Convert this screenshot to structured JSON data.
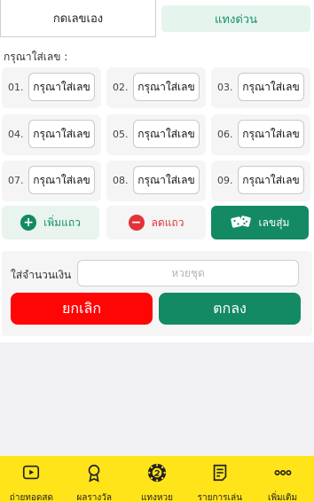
{
  "tabs": {
    "manual": "กดเลขเอง",
    "quick": "แทงด่วน"
  },
  "section_label": "กรุณาใส่เลข :",
  "number_inputs": {
    "placeholder": "กรุณาใส่เลข",
    "items": [
      {
        "label": "01."
      },
      {
        "label": "02."
      },
      {
        "label": "03."
      },
      {
        "label": "04."
      },
      {
        "label": "05."
      },
      {
        "label": "06."
      },
      {
        "label": "07."
      },
      {
        "label": "08."
      },
      {
        "label": "09."
      }
    ]
  },
  "actions": {
    "add_row": "เพิ่มแถว",
    "remove_row": "ลดแถว",
    "random": "เลขสุ่ม"
  },
  "amount": {
    "label": "ใส่จำนวนเงิน",
    "placeholder": "หวยชุด",
    "cancel": "ยกเลิก",
    "confirm": "ตกลง"
  },
  "bottom_nav": [
    {
      "label": "ถ่ายทอดสด",
      "icon": "play-video-icon"
    },
    {
      "label": "ผลรางวัล",
      "icon": "award-medal-icon"
    },
    {
      "label": "แทงหวย",
      "icon": "lottery-ball-icon"
    },
    {
      "label": "รายการเล่น",
      "icon": "list-document-icon"
    },
    {
      "label": "เพิ่มเติม",
      "icon": "more-dots-icon"
    }
  ],
  "colors": {
    "primary_green": "#138a63",
    "danger_red": "#ff0606",
    "nav_yellow": "#ffe41a"
  }
}
